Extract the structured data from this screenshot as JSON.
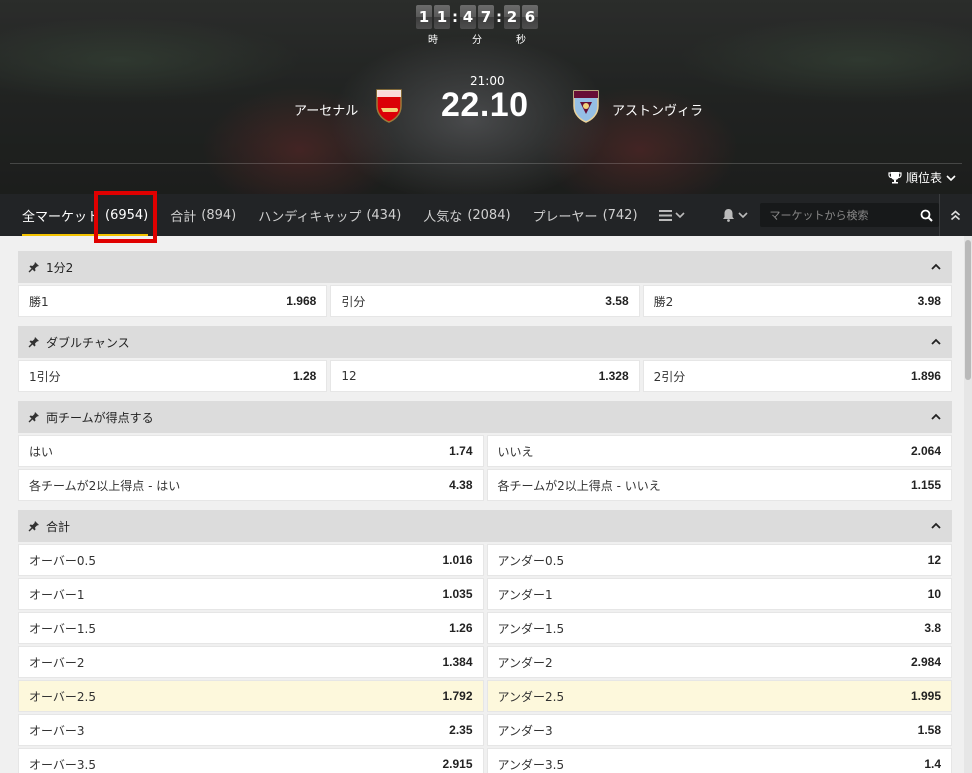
{
  "countdown": {
    "hours": [
      "1",
      "1"
    ],
    "minutes": [
      "4",
      "7"
    ],
    "seconds": [
      "2",
      "6"
    ],
    "hours_label": "時",
    "minutes_label": "分",
    "seconds_label": "秒"
  },
  "match": {
    "time": "21:00",
    "date": "22.10",
    "home": "アーセナル",
    "away": "アストンヴィラ",
    "standings_label": "順位表"
  },
  "tabs": [
    {
      "label": "全マーケット",
      "count": "(6954)"
    },
    {
      "label": "合計",
      "count": "(894)"
    },
    {
      "label": "ハンディキャップ",
      "count": "(434)"
    },
    {
      "label": "人気な",
      "count": "(2084)"
    },
    {
      "label": "プレーヤー",
      "count": "(742)"
    }
  ],
  "search": {
    "placeholder": "マーケットから検索"
  },
  "markets": [
    {
      "title": "1分2",
      "rows": [
        [
          {
            "label": "勝1",
            "price": "1.968"
          },
          {
            "label": "引分",
            "price": "3.58"
          },
          {
            "label": "勝2",
            "price": "3.98"
          }
        ]
      ]
    },
    {
      "title": "ダブルチャンス",
      "rows": [
        [
          {
            "label": "1引分",
            "price": "1.28"
          },
          {
            "label": "12",
            "price": "1.328"
          },
          {
            "label": "2引分",
            "price": "1.896"
          }
        ]
      ]
    },
    {
      "title": "両チームが得点する",
      "rows": [
        [
          {
            "label": "はい",
            "price": "1.74"
          },
          {
            "label": "いいえ",
            "price": "2.064"
          }
        ],
        [
          {
            "label": "各チームが2以上得点 - はい",
            "price": "4.38"
          },
          {
            "label": "各チームが2以上得点 - いいえ",
            "price": "1.155"
          }
        ]
      ]
    },
    {
      "title": "合計",
      "rows": [
        [
          {
            "label": "オーバー0.5",
            "price": "1.016"
          },
          {
            "label": "アンダー0.5",
            "price": "12"
          }
        ],
        [
          {
            "label": "オーバー1",
            "price": "1.035"
          },
          {
            "label": "アンダー1",
            "price": "10"
          }
        ],
        [
          {
            "label": "オーバー1.5",
            "price": "1.26"
          },
          {
            "label": "アンダー1.5",
            "price": "3.8"
          }
        ],
        [
          {
            "label": "オーバー2",
            "price": "1.384"
          },
          {
            "label": "アンダー2",
            "price": "2.984"
          }
        ],
        [
          {
            "label": "オーバー2.5",
            "price": "1.792"
          },
          {
            "label": "アンダー2.5",
            "price": "1.995"
          }
        ],
        [
          {
            "label": "オーバー3",
            "price": "2.35"
          },
          {
            "label": "アンダー3",
            "price": "1.58"
          }
        ],
        [
          {
            "label": "オーバー3.5",
            "price": "2.915"
          },
          {
            "label": "アンダー3.5",
            "price": "1.4"
          }
        ]
      ]
    }
  ],
  "colors": {
    "accent": "#f2c200",
    "highlight_box": "#e00000",
    "highlight_row": "#fdf8dc"
  }
}
